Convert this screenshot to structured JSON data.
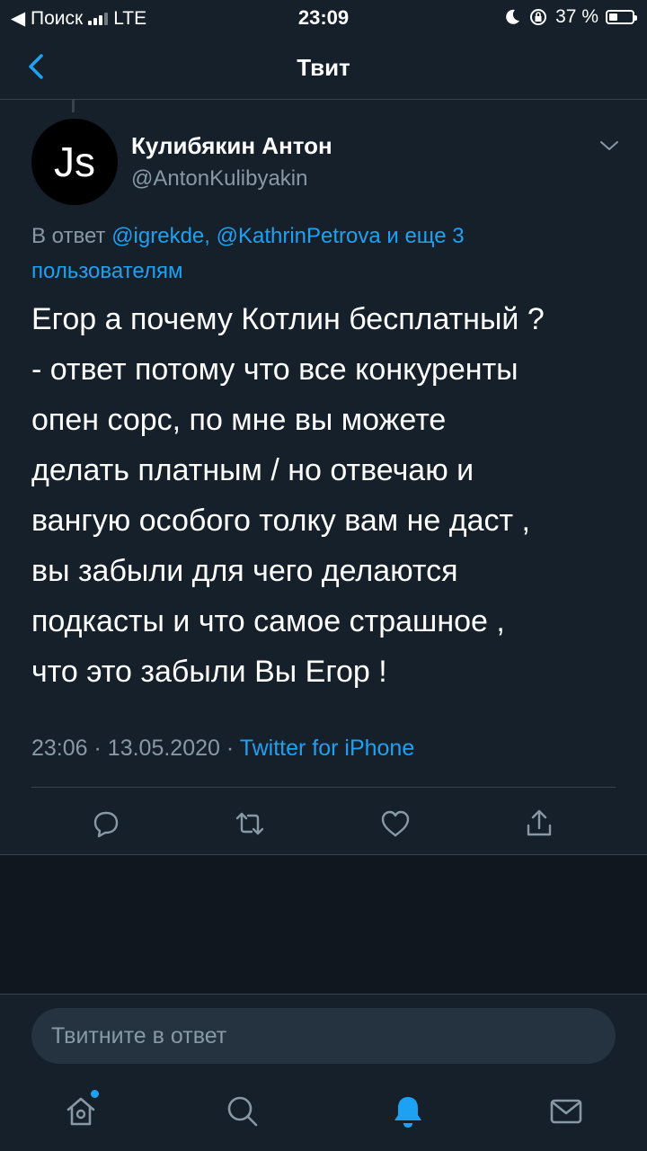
{
  "status_bar": {
    "back_app": "◀ Поиск",
    "network": "LTE",
    "time": "23:09",
    "battery_text": "37 %",
    "battery_level": 0.37
  },
  "nav": {
    "title": "Твит"
  },
  "tweet": {
    "avatar_text": "Js",
    "author_name": "Кулибякин Антон",
    "author_handle": "@AntonKulibyakin",
    "reply_prefix": "В ответ",
    "reply_links": "@igrekde, @KathrinPetrova и еще 3 пользователям",
    "text": "Егор а почему Котлин бесплатный ?\n- ответ потому что все конкуренты\nопен сорс, по мне вы можете\nделать платным / но отвечаю и\nвангую особого толку вам не даст ,\nвы забыли для чего делаются\nподкасты и что самое страшное ,\nчто это забыли Вы Егор !",
    "time": "23:06",
    "date": "13.05.2020",
    "separator": "·",
    "source": "Twitter for iPhone"
  },
  "composer": {
    "placeholder": "Твитните в ответ"
  },
  "tabs": [
    {
      "icon": "home-icon",
      "has_dot": true
    },
    {
      "icon": "search-icon"
    },
    {
      "icon": "bell-icon",
      "active": true
    },
    {
      "icon": "mail-icon"
    }
  ],
  "colors": {
    "background": "#15202b",
    "accent": "#1da1f2",
    "secondary_text": "#8899a6",
    "divider": "#38444d"
  }
}
